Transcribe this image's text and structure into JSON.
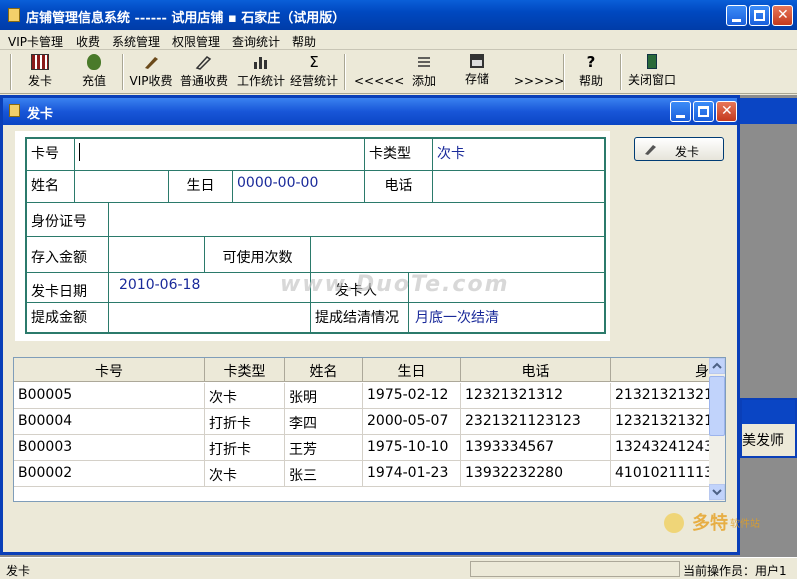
{
  "window": {
    "title": "店铺管理信息系统 ------ 试用店铺  ▪  石家庄（试用版）"
  },
  "menu": [
    "VIP卡管理",
    "收费",
    "系统管理",
    "权限管理",
    "查询统计",
    "帮助"
  ],
  "toolbar": {
    "issue_card": "发卡",
    "recharge": "充值",
    "vip_charge": "VIP收费",
    "normal_charge": "普通收费",
    "work_stats": "工作统计",
    "business_stats": "经营统计",
    "prev": "<<<<<",
    "add": "添加",
    "save": "存储",
    "next": ">>>>>",
    "help": "帮助",
    "close_window": "关闭窗口"
  },
  "subwindow": {
    "title": "发卡"
  },
  "form": {
    "card_no_label": "卡号",
    "card_no_value": "",
    "card_type_label": "卡类型",
    "card_type_value": "次卡",
    "name_label": "姓名",
    "name_value": "",
    "birthday_label": "生日",
    "birthday_value": "0000-00-00",
    "phone_label": "电话",
    "phone_value": "",
    "id_label": "身份证号",
    "id_value": "",
    "deposit_label": "存入金额",
    "deposit_value": "",
    "usable_times_label": "可使用次数",
    "usable_times_value": "",
    "issue_date_label": "发卡日期",
    "issue_date_value": "2010-06-18",
    "issuer_label": "发卡人",
    "issuer_value": "",
    "commission_label": "提成金额",
    "commission_value": "",
    "settle_label": "提成结清情况",
    "settle_value": "月底一次结清"
  },
  "issue_button": "发卡",
  "table": {
    "headers": [
      "卡号",
      "卡类型",
      "姓名",
      "生日",
      "电话",
      "身"
    ],
    "rows": [
      [
        "B00005",
        "次卡",
        "张明",
        "1975-02-12",
        "12321321312",
        "21321321321"
      ],
      [
        "B00004",
        "打折卡",
        "李四",
        "2000-05-07",
        "2321321123123",
        "12321321321"
      ],
      [
        "B00003",
        "打折卡",
        "王芳",
        "1975-10-10",
        "1393334567",
        "13243241243"
      ],
      [
        "B00002",
        "次卡",
        "张三",
        "1974-01-23",
        "13932232280",
        "41010211113"
      ]
    ]
  },
  "background_window_text": "美发师",
  "status": {
    "left": "发卡",
    "right": "当前操作员：用户1"
  },
  "watermark": "www.DuoTe.com",
  "colors": {
    "title_blue": "#0a45c4",
    "grid_green": "#2b7a6b",
    "value_blue": "#1a2a9a"
  }
}
